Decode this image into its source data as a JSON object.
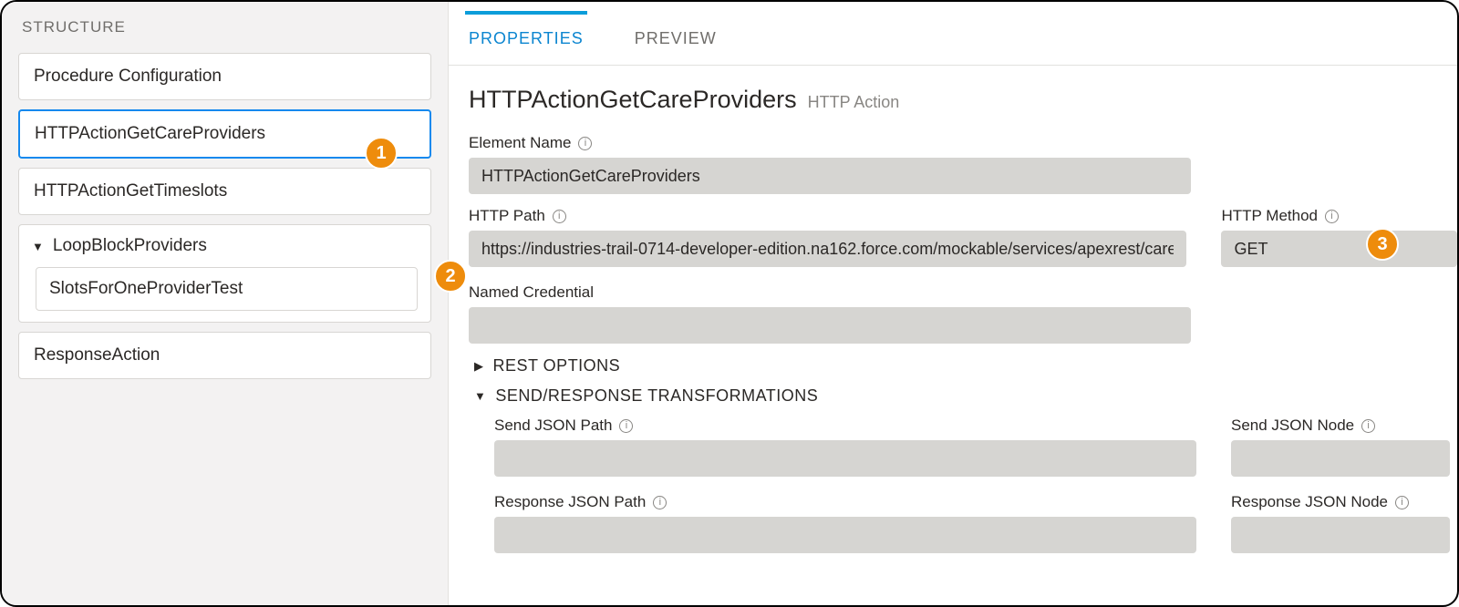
{
  "sidebar": {
    "title": "STRUCTURE",
    "items": [
      {
        "label": "Procedure Configuration"
      },
      {
        "label": "HTTPActionGetCareProviders",
        "active": true
      },
      {
        "label": "HTTPActionGetTimeslots"
      }
    ],
    "group": {
      "label": "LoopBlockProviders",
      "child": "SlotsForOneProviderTest"
    },
    "last": {
      "label": "ResponseAction"
    }
  },
  "tabs": {
    "properties": "PROPERTIES",
    "preview": "PREVIEW"
  },
  "header": {
    "title": "HTTPActionGetCareProviders",
    "subtitle": "HTTP Action"
  },
  "fields": {
    "element_name_label": "Element Name",
    "element_name_value": "HTTPActionGetCareProviders",
    "http_path_label": "HTTP Path",
    "http_path_value": "https://industries-trail-0714-developer-edition.na162.force.com/mockable/services/apexrest/care",
    "http_method_label": "HTTP Method",
    "http_method_value": "GET",
    "named_credential_label": "Named Credential",
    "named_credential_value": ""
  },
  "sections": {
    "rest_options": "REST OPTIONS",
    "send_response": "SEND/RESPONSE TRANSFORMATIONS"
  },
  "transform": {
    "send_json_path_label": "Send JSON Path",
    "send_json_path_value": "",
    "send_json_node_label": "Send JSON Node",
    "send_json_node_value": "",
    "response_json_path_label": "Response JSON Path",
    "response_json_path_value": "",
    "response_json_node_label": "Response JSON Node",
    "response_json_node_value": ""
  },
  "callouts": {
    "one": "1",
    "two": "2",
    "three": "3"
  }
}
